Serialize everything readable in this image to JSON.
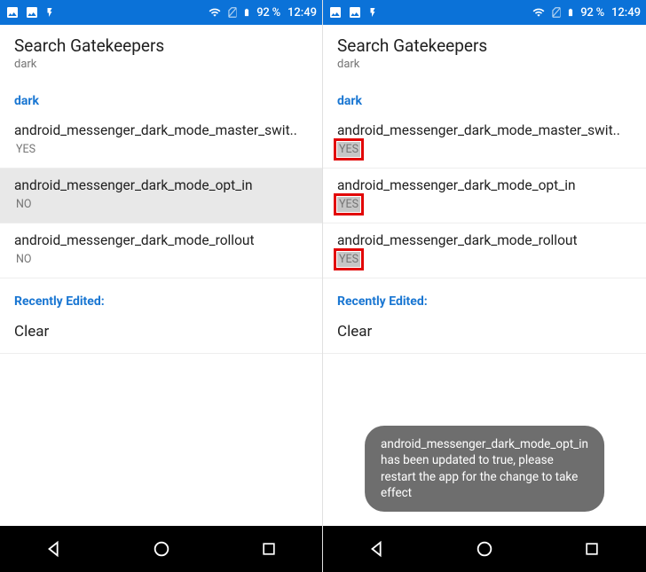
{
  "status": {
    "battery": "92 %",
    "time": "12:49"
  },
  "search": {
    "placeholder": "Search Gatekeepers",
    "query": "dark"
  },
  "section_label": "dark",
  "left": {
    "items": [
      {
        "title": "android_messenger_dark_mode_master_swit..",
        "value": "YES"
      },
      {
        "title": "android_messenger_dark_mode_opt_in",
        "value": "NO"
      },
      {
        "title": "android_messenger_dark_mode_rollout",
        "value": "NO"
      }
    ]
  },
  "right": {
    "items": [
      {
        "title": "android_messenger_dark_mode_master_swit..",
        "value": "YES"
      },
      {
        "title": "android_messenger_dark_mode_opt_in",
        "value": "YES"
      },
      {
        "title": "android_messenger_dark_mode_rollout",
        "value": "YES"
      }
    ],
    "toast": "android_messenger_dark_mode_opt_in has been updated to true, please restart the app for the change to take effect"
  },
  "recent_label": "Recently Edited:",
  "clear_label": "Clear"
}
